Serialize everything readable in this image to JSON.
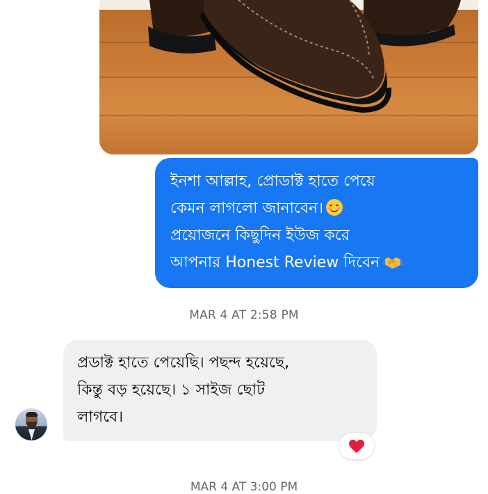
{
  "shared_photo": {
    "description": "Product photo: brown suede loafers on a wooden floor",
    "colors": {
      "floor": "#c97b36",
      "shoe": "#3a2418",
      "sole": "#151515",
      "stitch": "#a9876a"
    }
  },
  "outgoing_message": {
    "lines": [
      "ইনশা আল্লাহ, প্রোডাক্ট হাতে পেয়ে",
      "কেমন লাগলো জানাবেন।",
      "প্রয়োজনে কিছুদিন ইউজ করে",
      "আপনার Honest Review দিবেন"
    ],
    "emoji_line2": "smiling-face-emoji",
    "emoji_line4": "handshake-emoji",
    "bubble_color": "#1877f2"
  },
  "timestamp": "MAR 4 AT 2:58 PM",
  "incoming_message": {
    "lines": [
      "প্রডাক্ট হাতে পেয়েছি। পছন্দ হয়েছে,",
      "কিন্তু বড় হয়েছে। ১ সাইজ ছোট",
      "লাগবে।"
    ],
    "bubble_color": "#f0f0f0",
    "sender_avatar": "avatar-man-with-beard",
    "reaction": "heart-emoji"
  },
  "next_timestamp_partial": "MAR 4 AT 3:00 PM"
}
